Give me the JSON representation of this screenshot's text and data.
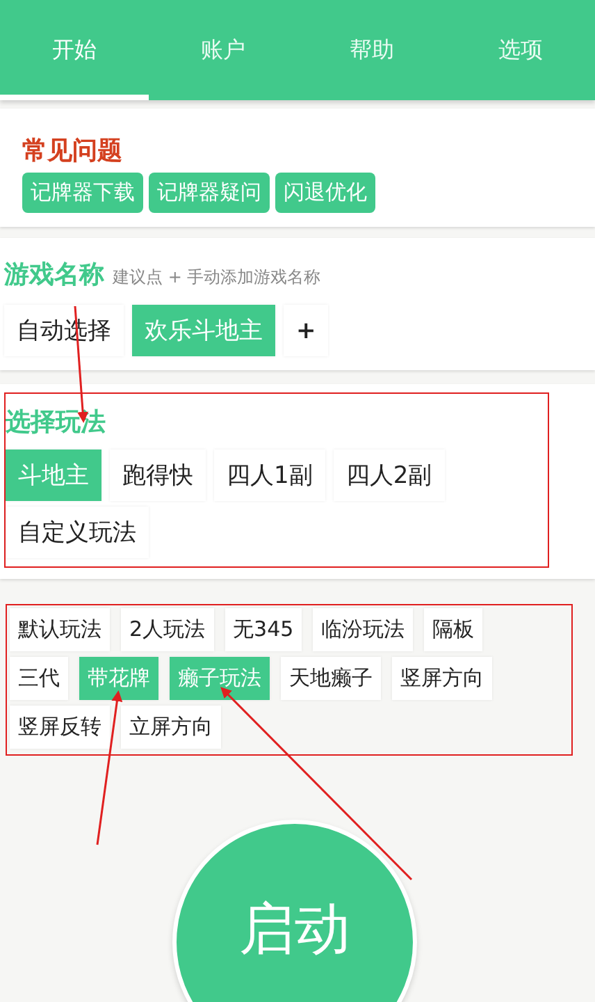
{
  "tabs": [
    {
      "label": "开始",
      "selected": true
    },
    {
      "label": "账户",
      "selected": false
    },
    {
      "label": "帮助",
      "selected": false
    },
    {
      "label": "选项",
      "selected": false
    }
  ],
  "faq": {
    "title": "常见问题",
    "buttons": [
      "记牌器下载",
      "记牌器疑问",
      "闪退优化"
    ]
  },
  "game_name": {
    "title": "游戏名称",
    "hint": "建议点 + 手动添加游戏名称",
    "items": [
      {
        "label": "自动选择",
        "selected": false
      },
      {
        "label": "欢乐斗地主",
        "selected": true
      }
    ],
    "add_button": "+"
  },
  "play_mode": {
    "title": "选择玩法",
    "items": [
      {
        "label": "斗地主",
        "selected": true
      },
      {
        "label": "跑得快",
        "selected": false
      },
      {
        "label": "四人1副",
        "selected": false
      },
      {
        "label": "四人2副",
        "selected": false
      },
      {
        "label": "自定义玩法",
        "selected": false
      }
    ]
  },
  "options": [
    {
      "label": "默认玩法",
      "selected": false
    },
    {
      "label": "2人玩法",
      "selected": false
    },
    {
      "label": "无345",
      "selected": false
    },
    {
      "label": "临汾玩法",
      "selected": false
    },
    {
      "label": "隔板",
      "selected": false
    },
    {
      "label": "三代",
      "selected": false
    },
    {
      "label": "带花牌",
      "selected": true
    },
    {
      "label": "癞子玩法",
      "selected": true
    },
    {
      "label": "天地癞子",
      "selected": false
    },
    {
      "label": "竖屏方向",
      "selected": false
    },
    {
      "label": "竖屏反转",
      "selected": false
    },
    {
      "label": "立屏方向",
      "selected": false
    }
  ],
  "start_button": "启动"
}
